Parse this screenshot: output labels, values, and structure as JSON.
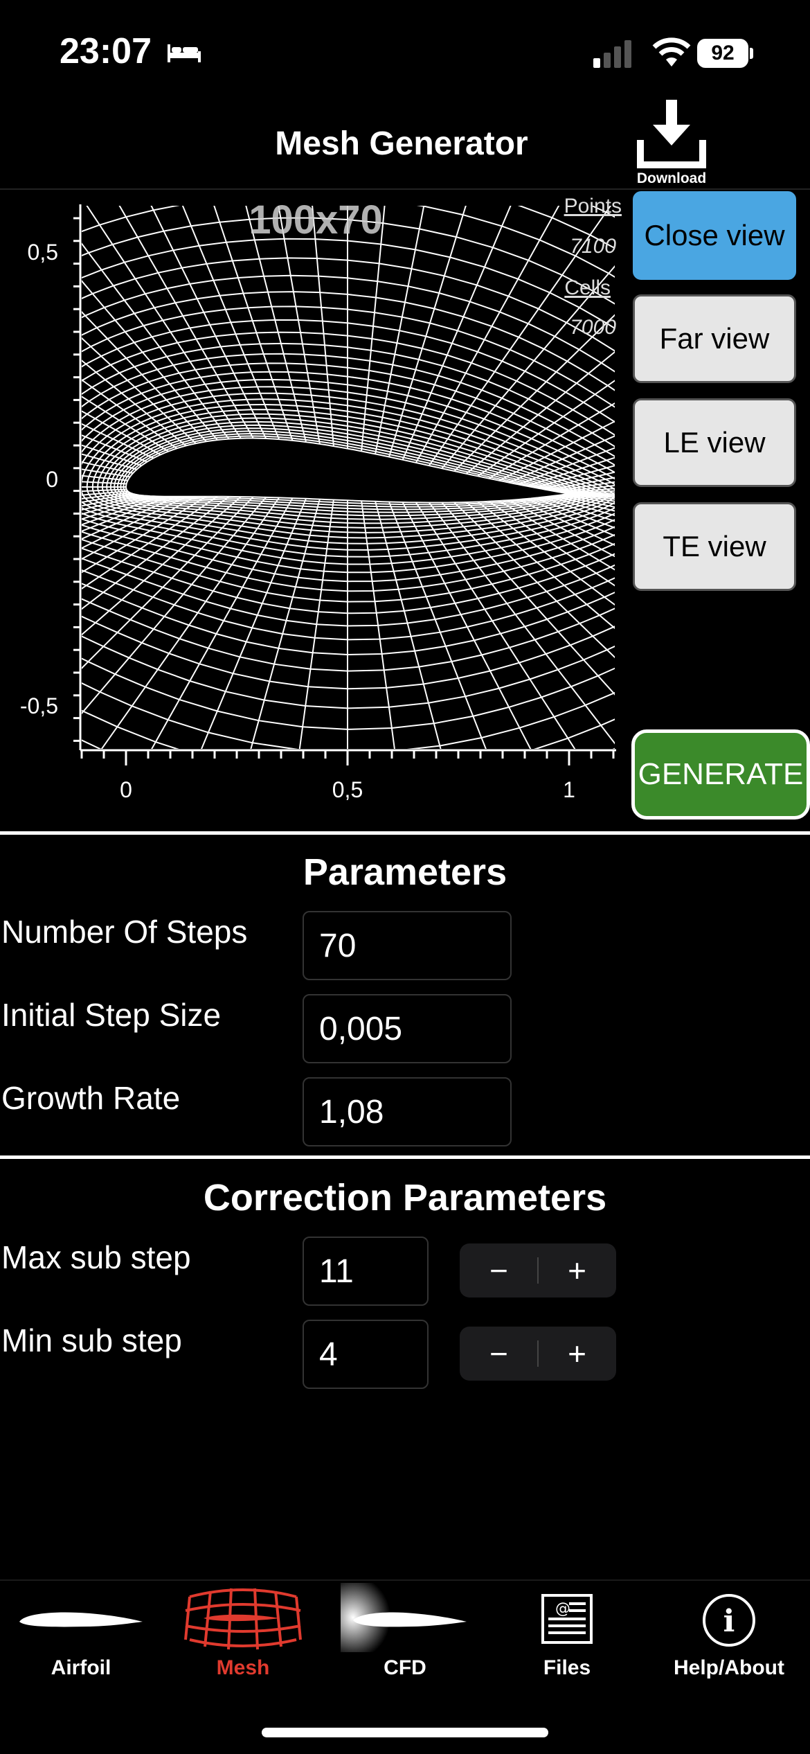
{
  "status": {
    "time": "23:07",
    "battery": "92"
  },
  "header": {
    "title": "Mesh Generator",
    "download_label": "Download"
  },
  "plot": {
    "mesh_size": "100x70",
    "points_label": "Points",
    "points_value": "7100",
    "cells_label": "Cells",
    "cells_value": "7000",
    "y_ticks": [
      "0,5",
      "0",
      "-0,5"
    ],
    "x_ticks": [
      "0",
      "0,5",
      "1"
    ]
  },
  "view_buttons": {
    "close": "Close view",
    "far": "Far view",
    "le": "LE view",
    "te": "TE view",
    "active": "close"
  },
  "generate_label": "GENERATE",
  "parameters": {
    "title": "Parameters",
    "steps_label": "Number Of Steps",
    "steps_value": "70",
    "initial_label": "Initial Step Size",
    "initial_value": "0,005",
    "growth_label": "Growth Rate",
    "growth_value": "1,08"
  },
  "correction": {
    "title": "Correction Parameters",
    "max_label": "Max sub step",
    "max_value": "11",
    "min_label": "Min sub step",
    "min_value": "4",
    "minus": "−",
    "plus": "+"
  },
  "tabs": [
    {
      "label": "Airfoil",
      "icon": "airfoil-icon"
    },
    {
      "label": "Mesh",
      "icon": "mesh-icon",
      "active": true
    },
    {
      "label": "CFD",
      "icon": "cfd-icon"
    },
    {
      "label": "Files",
      "icon": "files-icon"
    },
    {
      "label": "Help/About",
      "icon": "info-icon"
    }
  ],
  "colors": {
    "accent_blue": "#4aa6e2",
    "generate_green": "#3b8a2a",
    "active_tab": "#e03a2e"
  }
}
